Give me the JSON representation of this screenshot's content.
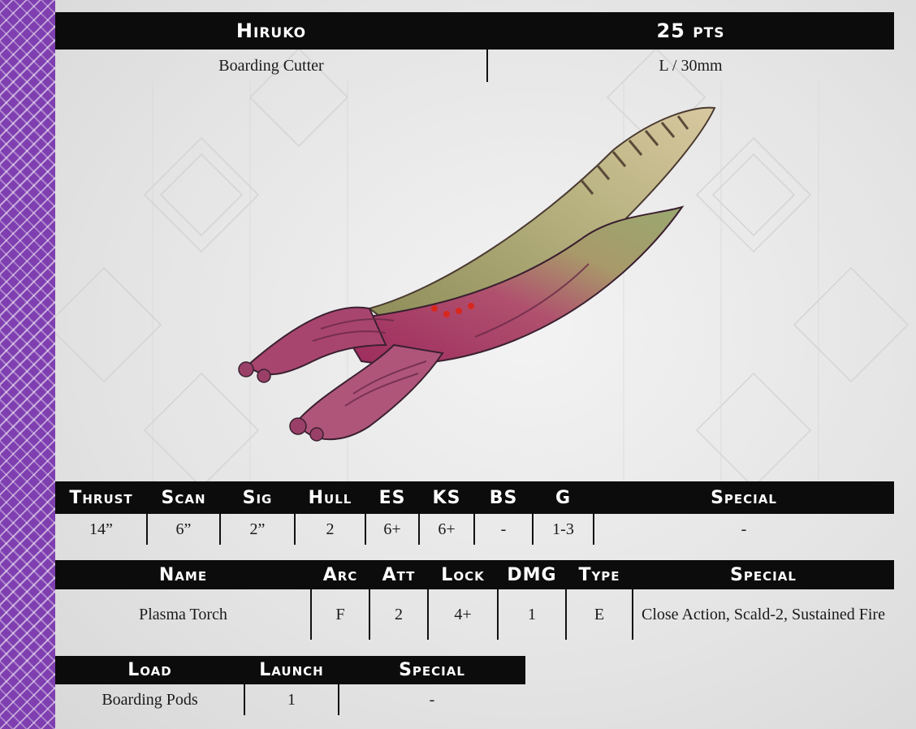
{
  "header": {
    "name": "Hiruko",
    "points": "25 pts"
  },
  "subheader": {
    "type": "Boarding Cutter",
    "size": "L / 30mm"
  },
  "ship_image": {
    "icon": "alien-cruiser-miniature"
  },
  "stats": {
    "headers": [
      "Thrust",
      "Scan",
      "Sig",
      "Hull",
      "ES",
      "KS",
      "BS",
      "G",
      "Special"
    ],
    "values": [
      "14”",
      "6”",
      "2”",
      "2",
      "6+",
      "6+",
      "-",
      "1-3",
      "-"
    ]
  },
  "weapons": {
    "headers": [
      "Name",
      "Arc",
      "Att",
      "Lock",
      "DMG",
      "Type",
      "Special"
    ],
    "rows": [
      [
        "Plasma Torch",
        "F",
        "2",
        "4+",
        "1",
        "E",
        "Close Action, Scald-2, Sustained Fire"
      ]
    ]
  },
  "launch": {
    "headers": [
      "Load",
      "Launch",
      "Special"
    ],
    "rows": [
      [
        "Boarding Pods",
        "1",
        "-"
      ]
    ]
  },
  "colors": {
    "accent": "#7f3fb0",
    "bar": "#0c0c0c"
  }
}
